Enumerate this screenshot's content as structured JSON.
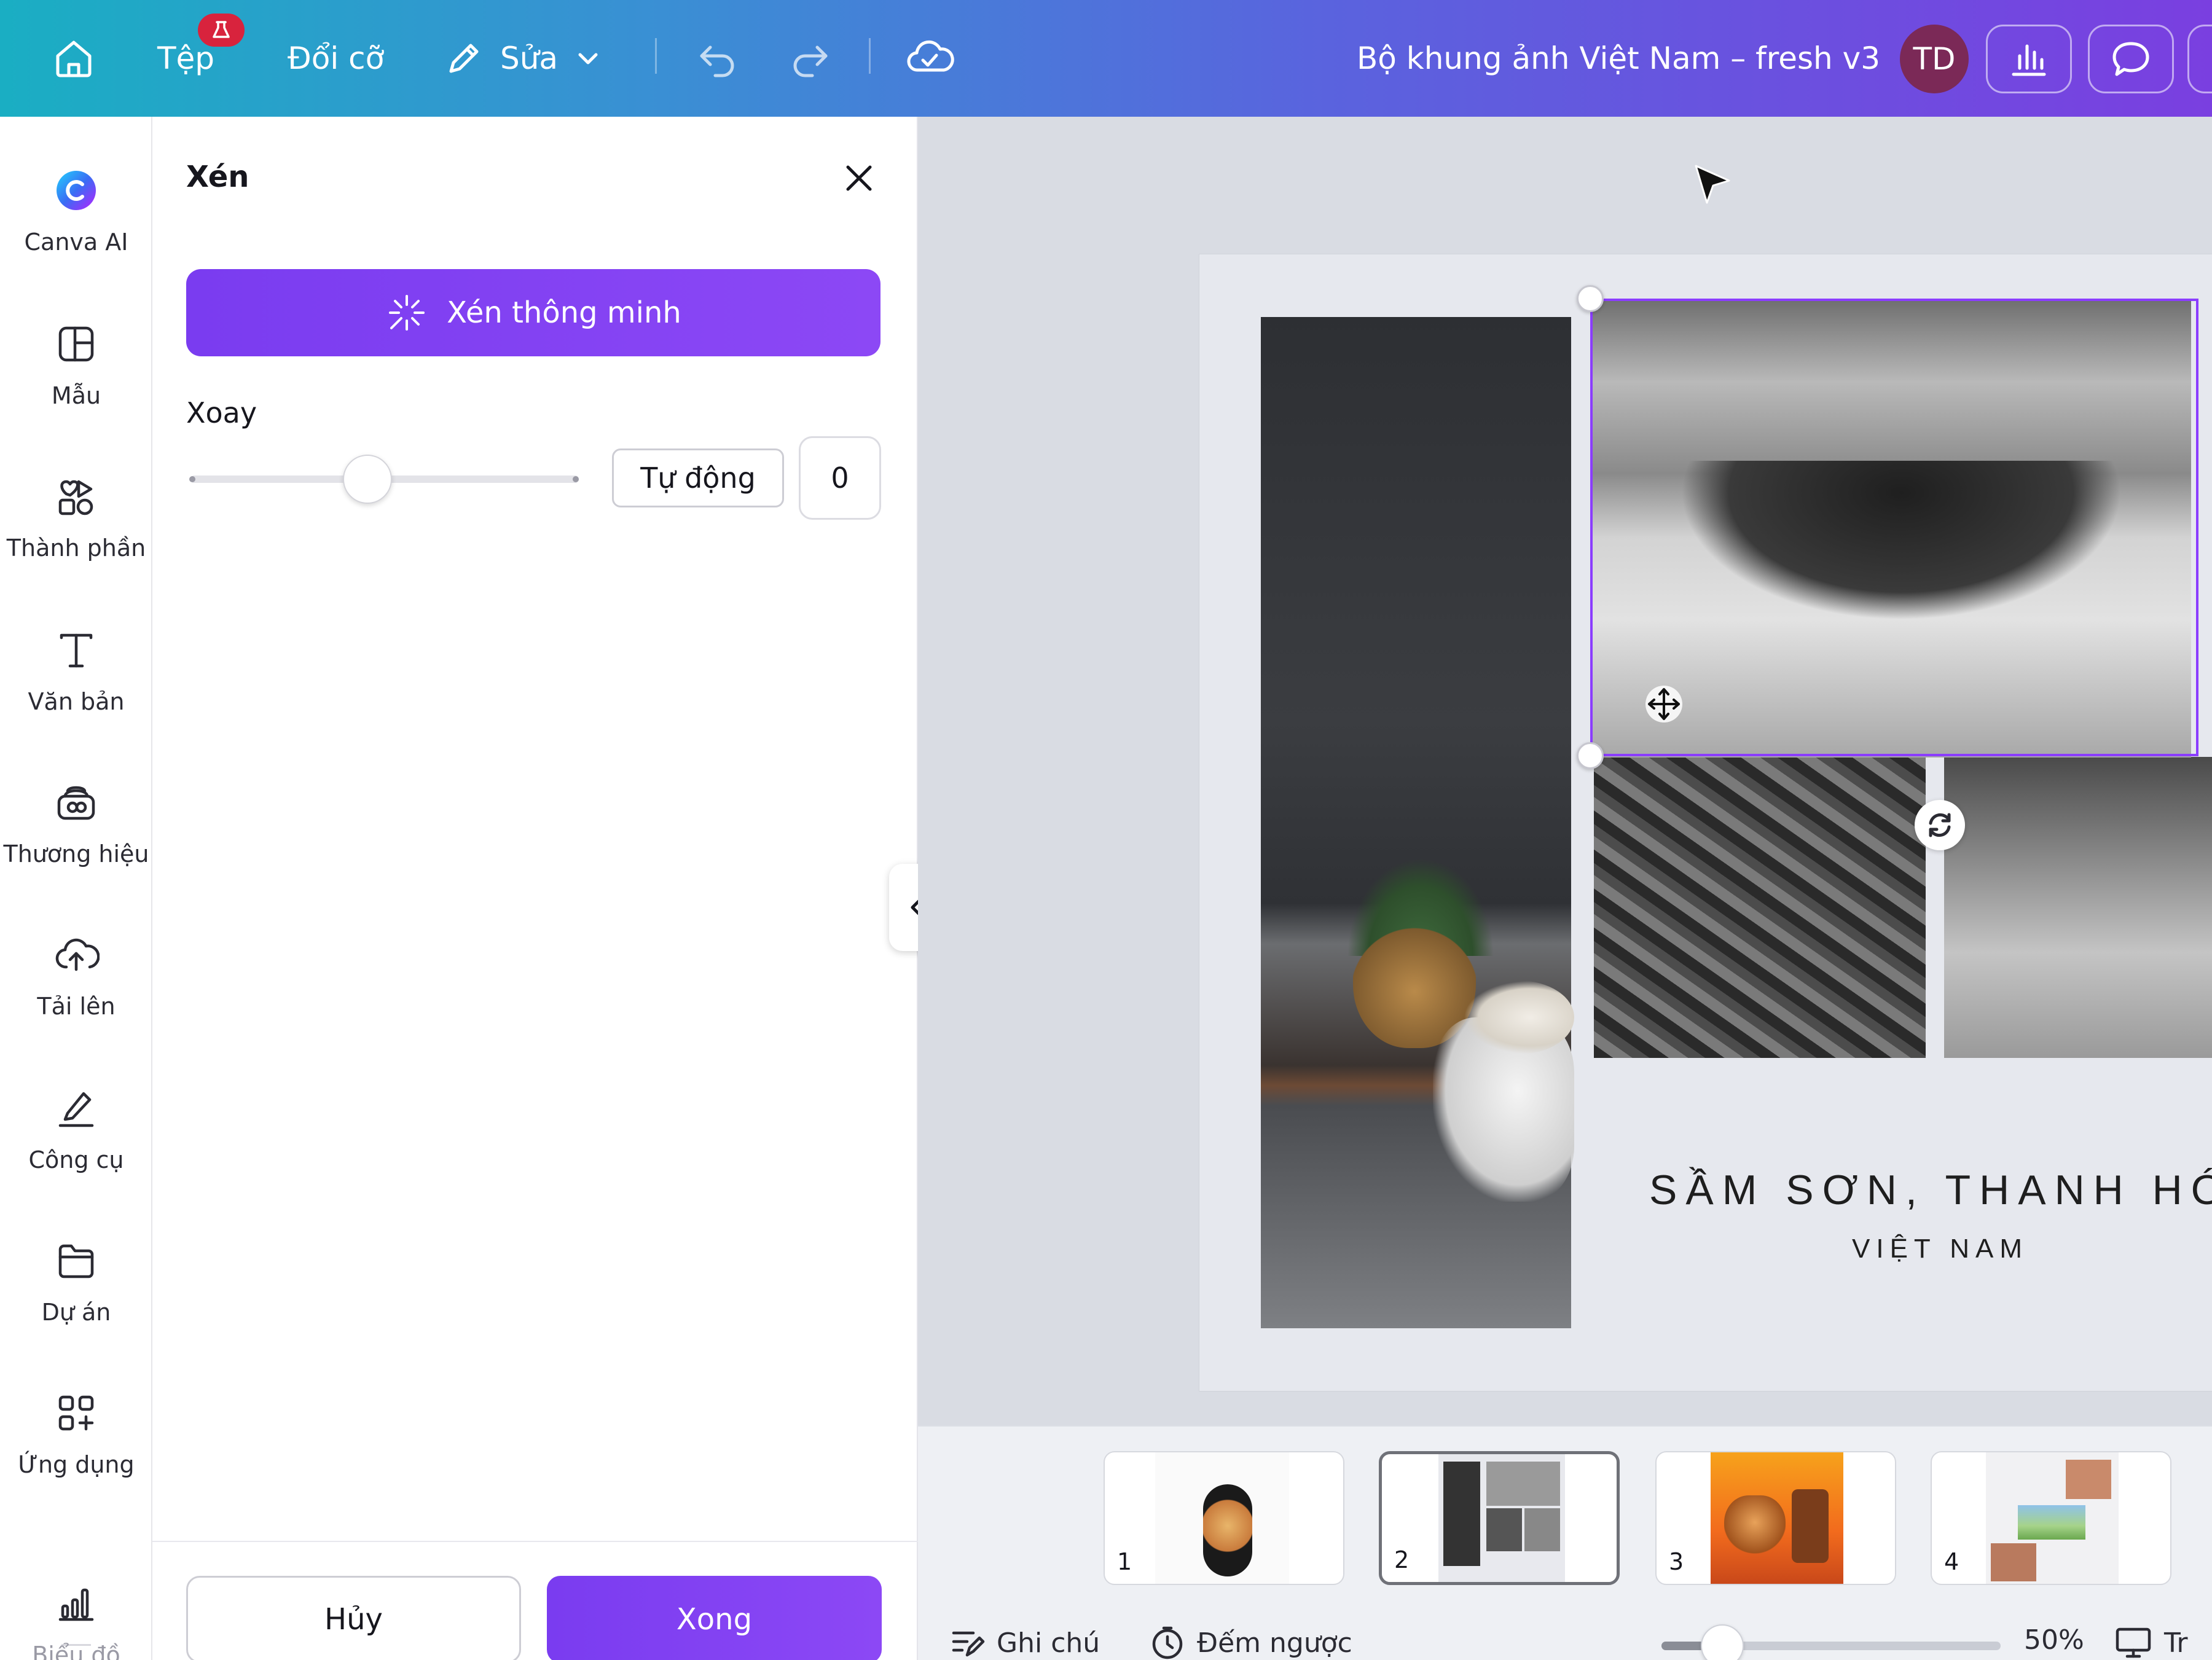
{
  "topbar": {
    "file_label": "Tệp",
    "resize_label": "Đổi cỡ",
    "edit_label": "Sửa",
    "doc_title": "Bộ khung ảnh Việt Nam – fresh v3",
    "avatar_initials": "TD",
    "gradient_start": "#1aaec3",
    "gradient_end": "#7a3fe0",
    "badge_color": "#d8233d",
    "avatar_color": "#7b2957",
    "icons": [
      "home-icon",
      "beaker-icon",
      "pencil-icon",
      "chevron-down-icon",
      "undo-icon",
      "redo-icon",
      "cloud-check-icon",
      "bar-chart-icon",
      "comment-icon"
    ]
  },
  "rail": {
    "items": [
      {
        "label": "Canva AI",
        "icon": "canva-ai-icon"
      },
      {
        "label": "Mẫu",
        "icon": "template-icon"
      },
      {
        "label": "Thành phần",
        "icon": "elements-icon"
      },
      {
        "label": "Văn bản",
        "icon": "text-icon"
      },
      {
        "label": "Thương hiệu",
        "icon": "brand-icon"
      },
      {
        "label": "Tải lên",
        "icon": "upload-cloud-icon"
      },
      {
        "label": "Công cụ",
        "icon": "draw-tool-icon"
      },
      {
        "label": "Dự án",
        "icon": "folder-icon"
      },
      {
        "label": "Ứng dụng",
        "icon": "apps-icon"
      },
      {
        "label": "Biểu đồ",
        "icon": "chart-icon"
      }
    ]
  },
  "crop_panel": {
    "title": "Xén",
    "smart_crop_label": "Xén thông minh",
    "rotate_label": "Xoay",
    "auto_label": "Tự động",
    "rotate_value": "0",
    "rotate_slider_position": 0.5,
    "cancel_label": "Hủy",
    "done_label": "Xong",
    "accent_color": "#8b3dff"
  },
  "canvas": {
    "caption_main": "SẦM SƠN, THANH HÓA",
    "caption_sub": "VIỆT NAM"
  },
  "pages": [
    {
      "number": "1",
      "active": false
    },
    {
      "number": "2",
      "active": true
    },
    {
      "number": "3",
      "active": false
    },
    {
      "number": "4",
      "active": false
    }
  ],
  "bottom_bar": {
    "notes_label": "Ghi chú",
    "timer_label": "Đếm ngược",
    "zoom_level": "50%",
    "zoom_fraction": 0.18,
    "view_label": "Tr"
  }
}
